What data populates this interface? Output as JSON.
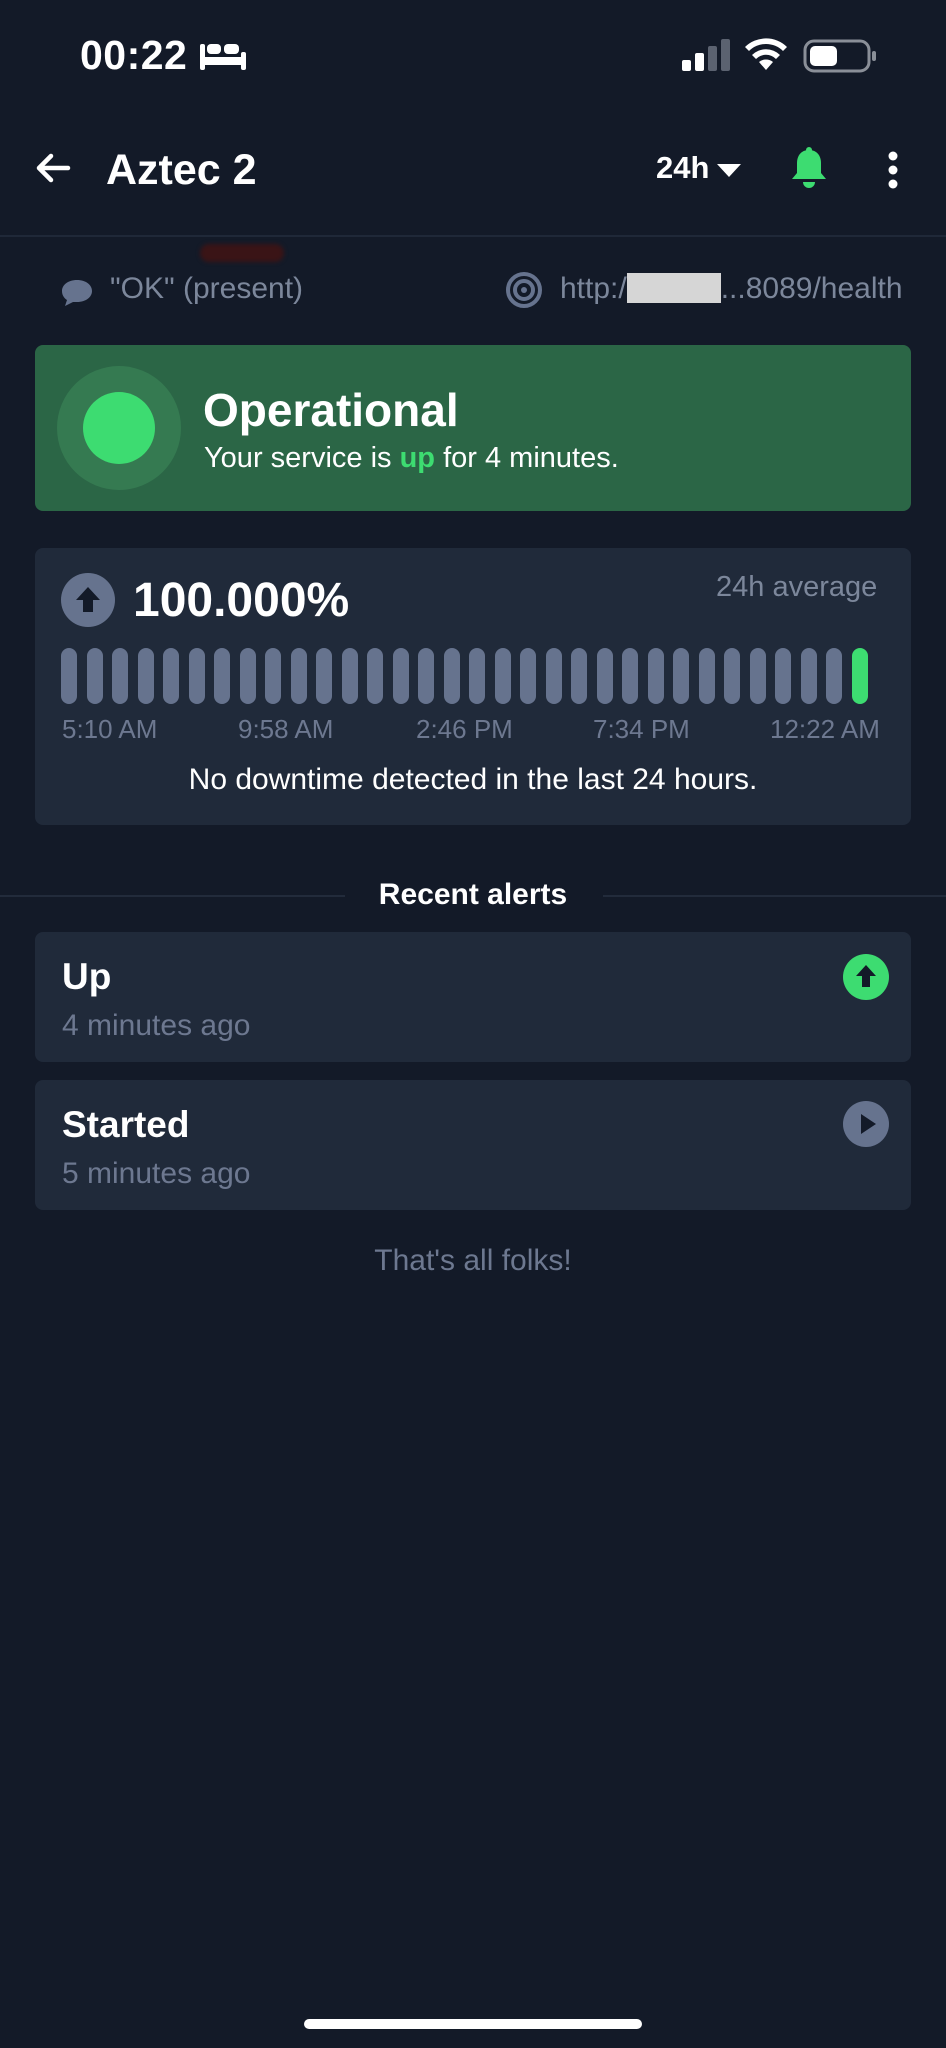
{
  "status_bar": {
    "time": "00:22",
    "icons": [
      "bed-icon",
      "signal-icon",
      "wifi-icon",
      "battery-icon"
    ]
  },
  "app_bar": {
    "title": "Aztec 2",
    "range_label": "24h",
    "icons": [
      "back-arrow-icon",
      "caret-down-icon",
      "bell-icon",
      "more-vertical-icon"
    ]
  },
  "info": {
    "keyword": "\"OK\" (present)",
    "url_prefix": "http:/",
    "url_suffix": "...8089/health"
  },
  "status": {
    "title": "Operational",
    "subtitle_prefix": "Your service is ",
    "subtitle_highlight": "up",
    "subtitle_suffix": " for 4 minutes."
  },
  "uptime": {
    "value": "100.000%",
    "caption": "24h average",
    "bar_count": 32,
    "ticks": [
      "5:10 AM",
      "9:58 AM",
      "2:46 PM",
      "7:34 PM",
      "12:22 AM"
    ],
    "message": "No downtime detected in the last 24 hours."
  },
  "alerts": {
    "heading": "Recent alerts",
    "items": [
      {
        "title": "Up",
        "time": "4 minutes ago",
        "icon": "arrow-up-circle-icon"
      },
      {
        "title": "Started",
        "time": "5 minutes ago",
        "icon": "play-circle-icon"
      }
    ],
    "end_text": "That's all folks!"
  },
  "colors": {
    "background": "#131a28",
    "card": "#202a3a",
    "operational_card": "#2b6646",
    "accent_green": "#3ddc71",
    "muted_text": "#7c879b",
    "bar_gray": "#66738e"
  }
}
